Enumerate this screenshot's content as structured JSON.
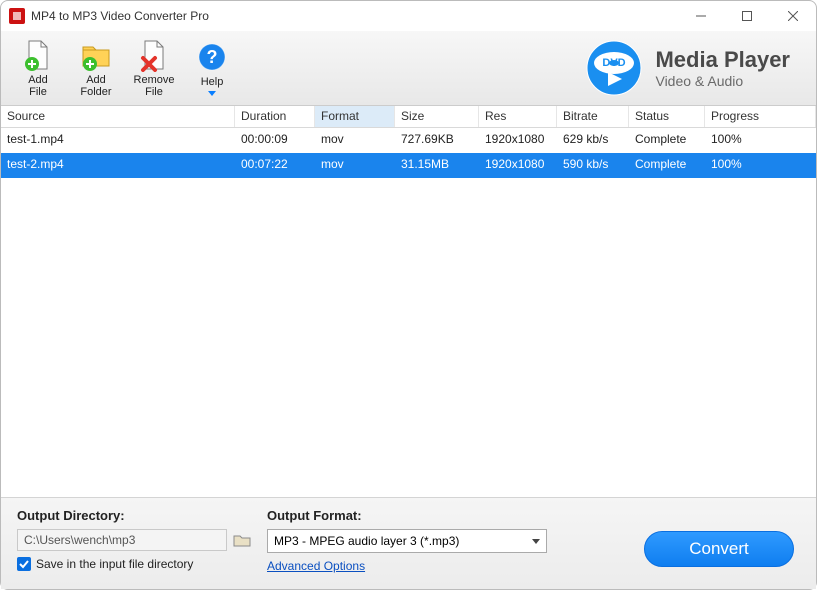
{
  "window": {
    "title": "MP4 to MP3 Video Converter Pro"
  },
  "toolbar": {
    "add_file": "Add\nFile",
    "add_folder": "Add\nFolder",
    "remove_file": "Remove\nFile",
    "help": "Help"
  },
  "brand": {
    "line1": "Media Player",
    "line2": "Video & Audio",
    "logo_label": "DVD"
  },
  "columns": [
    "Source",
    "Duration",
    "Format",
    "Size",
    "Res",
    "Bitrate",
    "Status",
    "Progress"
  ],
  "sorted_column_index": 2,
  "rows": [
    {
      "source": "test-1.mp4",
      "duration": "00:00:09",
      "format": "mov",
      "size": "727.69KB",
      "res": "1920x1080",
      "bitrate": "629 kb/s",
      "status": "Complete",
      "progress": "100%",
      "selected": false
    },
    {
      "source": "test-2.mp4",
      "duration": "00:07:22",
      "format": "mov",
      "size": "31.15MB",
      "res": "1920x1080",
      "bitrate": "590 kb/s",
      "status": "Complete",
      "progress": "100%",
      "selected": true
    }
  ],
  "output": {
    "dir_label": "Output Directory:",
    "dir_value": "C:\\Users\\wench\\mp3",
    "save_in_input_label": "Save in the input file directory",
    "save_in_input_checked": true,
    "format_label": "Output Format:",
    "format_value": "MP3 - MPEG audio layer 3 (*.mp3)",
    "advanced_label": "Advanced Options",
    "convert_label": "Convert"
  }
}
